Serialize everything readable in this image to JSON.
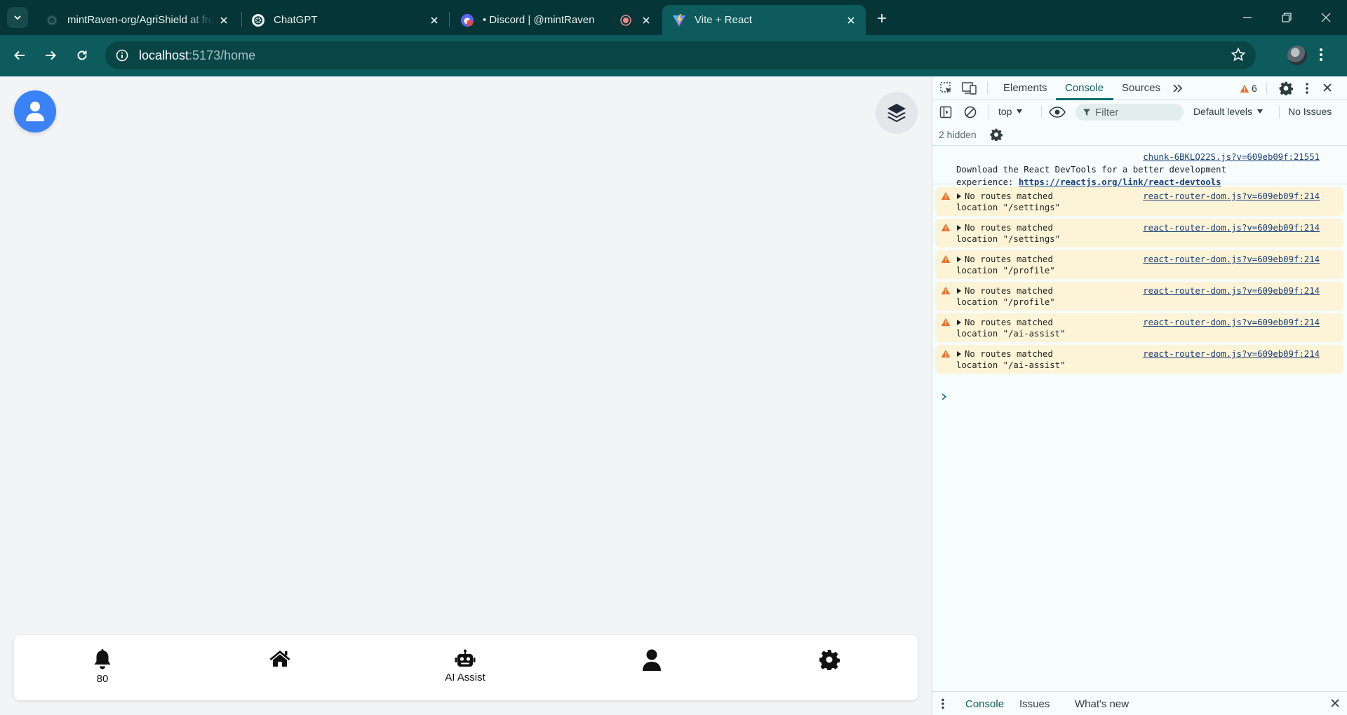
{
  "browser": {
    "tabs": [
      {
        "title": "mintRaven-org/AgriShield at fro",
        "icon": "github-icon"
      },
      {
        "title": "ChatGPT",
        "icon": "chatgpt-icon"
      },
      {
        "title": "• Discord | @mintRaven",
        "icon": "discord-icon"
      },
      {
        "title": "Vite + React",
        "icon": "vite-icon",
        "active": true
      }
    ],
    "url_host": "localhost",
    "url_path": ":5173/home"
  },
  "app": {
    "nav_items": [
      {
        "icon": "bell-icon",
        "label": "80"
      },
      {
        "icon": "home-icon",
        "label": ""
      },
      {
        "icon": "robot-icon",
        "label": "AI Assist"
      },
      {
        "icon": "user-icon",
        "label": ""
      },
      {
        "icon": "gear-icon",
        "label": ""
      }
    ]
  },
  "devtools": {
    "tabs": [
      "Elements",
      "Console",
      "Sources"
    ],
    "active_tab": "Console",
    "warning_count": "6",
    "context": "top",
    "filter_placeholder": "Filter",
    "levels": "Default levels",
    "issues": "No Issues",
    "hidden": "2 hidden",
    "info_message": {
      "source": "chunk-6BKLQ22S.js?v=609eb09f:21551",
      "line1": "Download the React DevTools for a better development",
      "line2_prefix": "experience: ",
      "link": "https://reactjs.org/link/react-devtools"
    },
    "warnings": [
      {
        "text": "No routes matched",
        "location": "location \"/settings\"",
        "source": "react-router-dom.js?v=609eb09f:214"
      },
      {
        "text": "No routes matched",
        "location": "location \"/settings\"",
        "source": "react-router-dom.js?v=609eb09f:214"
      },
      {
        "text": "No routes matched",
        "location": "location \"/profile\"",
        "source": "react-router-dom.js?v=609eb09f:214"
      },
      {
        "text": "No routes matched",
        "location": "location \"/profile\"",
        "source": "react-router-dom.js?v=609eb09f:214"
      },
      {
        "text": "No routes matched",
        "location": "location \"/ai-assist\"",
        "source": "react-router-dom.js?v=609eb09f:214"
      },
      {
        "text": "No routes matched",
        "location": "location \"/ai-assist\"",
        "source": "react-router-dom.js?v=609eb09f:214"
      }
    ],
    "drawer_tabs": [
      "Console",
      "Issues",
      "What's new"
    ]
  },
  "colors": {
    "browser_dark": "#053536",
    "browser_toolbar": "#0d5b5c",
    "profile_button": "#3b82f6",
    "warning_bg": "#fdf3d6",
    "warning_icon": "#e8702a"
  }
}
